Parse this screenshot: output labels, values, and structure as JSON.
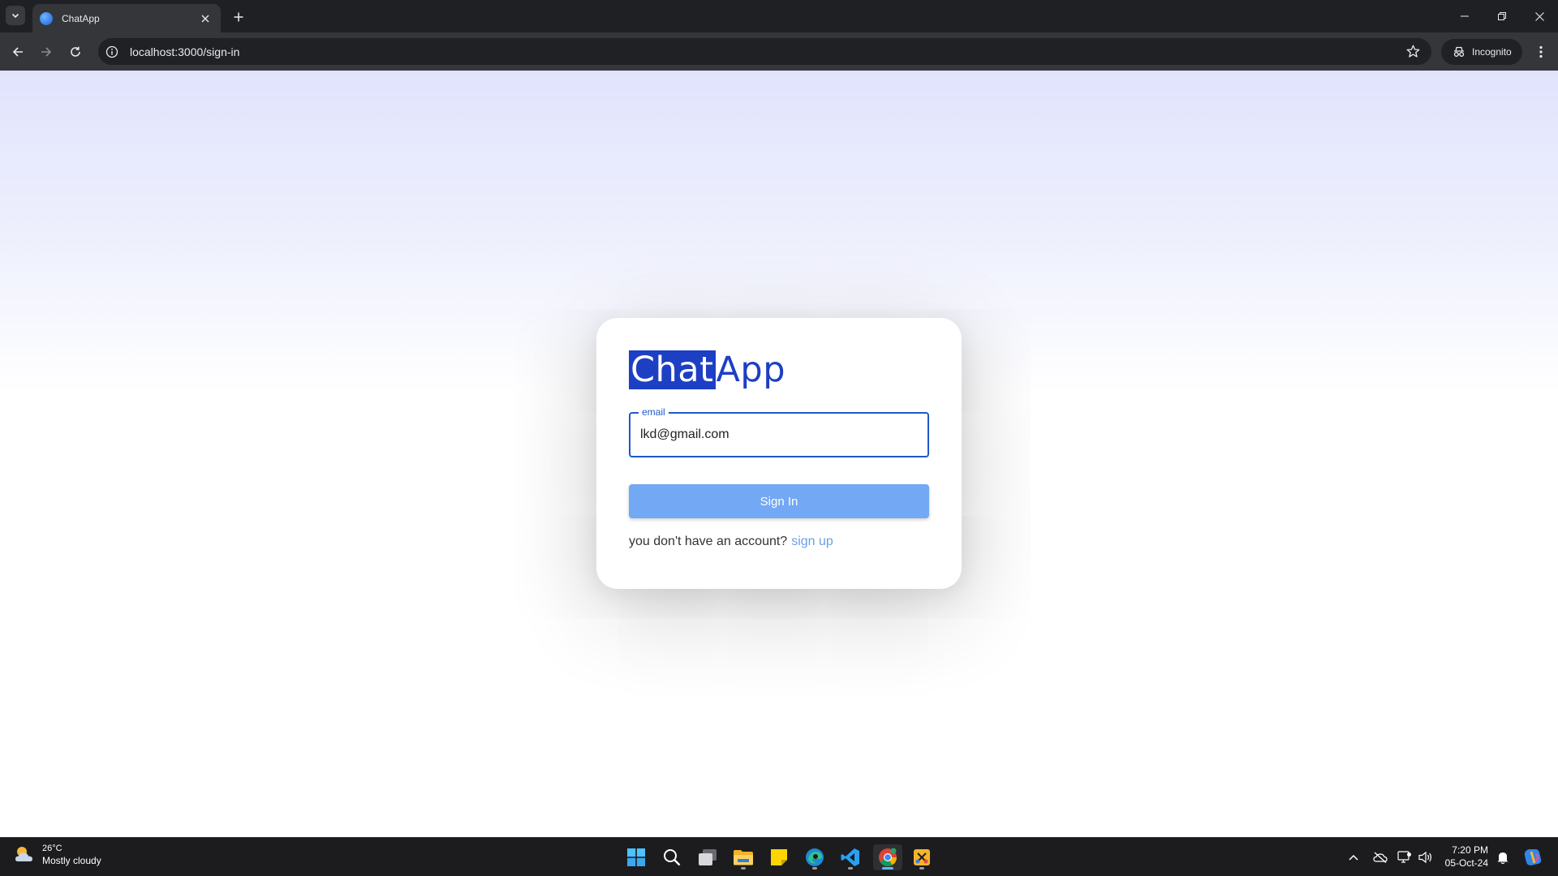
{
  "browser": {
    "tab_title": "ChatApp",
    "url": "localhost:3000/sign-in",
    "incognito_label": "Incognito"
  },
  "login": {
    "logo_highlight": "Chat",
    "logo_rest": "App",
    "email_label": "email",
    "email_value": "lkd@gmail.com",
    "signin_label": "Sign In",
    "no_account_text": "you don't have an account?",
    "signup_link": "sign up"
  },
  "taskbar": {
    "weather_temp": "26°C",
    "weather_desc": "Mostly cloudy",
    "time": "7:20 PM",
    "date": "05-Oct-24"
  },
  "colors": {
    "accent": "#1d3fc4",
    "field_border": "#1f58c7",
    "button": "#73a8f4",
    "link": "#6a9ee8"
  }
}
